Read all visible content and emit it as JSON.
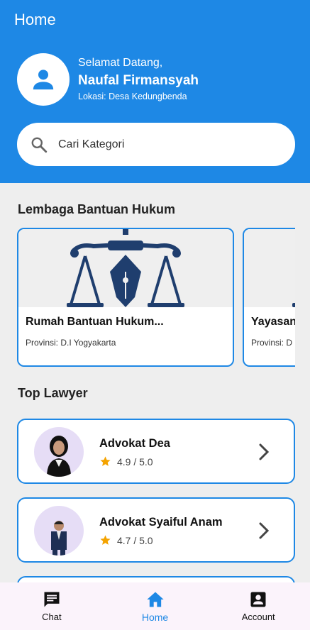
{
  "header": {
    "title": "Home",
    "welcome": "Selamat Datang,",
    "user_name": "Naufal Firmansyah",
    "location": "Lokasi: Desa Kedungbenda"
  },
  "search": {
    "placeholder": "Cari Kategori",
    "icon": "search-icon"
  },
  "sections": {
    "legal_aid_title": "Lembaga Bantuan Hukum",
    "top_lawyer_title": "Top Lawyer"
  },
  "legal_aid_cards": [
    {
      "name": "Rumah Bantuan Hukum...",
      "province": "Provinsi: D.I Yogyakarta",
      "image": "scales-of-justice-logo"
    },
    {
      "name": "Yayasan",
      "province": "Provinsi: D",
      "image": "scales-of-justice-logo"
    }
  ],
  "lawyers": [
    {
      "name": "Advokat Dea",
      "rating": "4.9 / 5.0"
    },
    {
      "name": "Advokat Syaiful Anam",
      "rating": "4.7 / 5.0"
    }
  ],
  "bottom_nav": [
    {
      "label": "Chat",
      "icon": "chat-icon",
      "active": false
    },
    {
      "label": "Home",
      "icon": "home-icon",
      "active": true
    },
    {
      "label": "Account",
      "icon": "account-box-icon",
      "active": false
    }
  ],
  "colors": {
    "primary": "#1e88e5",
    "logo_navy": "#1f3e6e",
    "star": "#f4a300"
  }
}
